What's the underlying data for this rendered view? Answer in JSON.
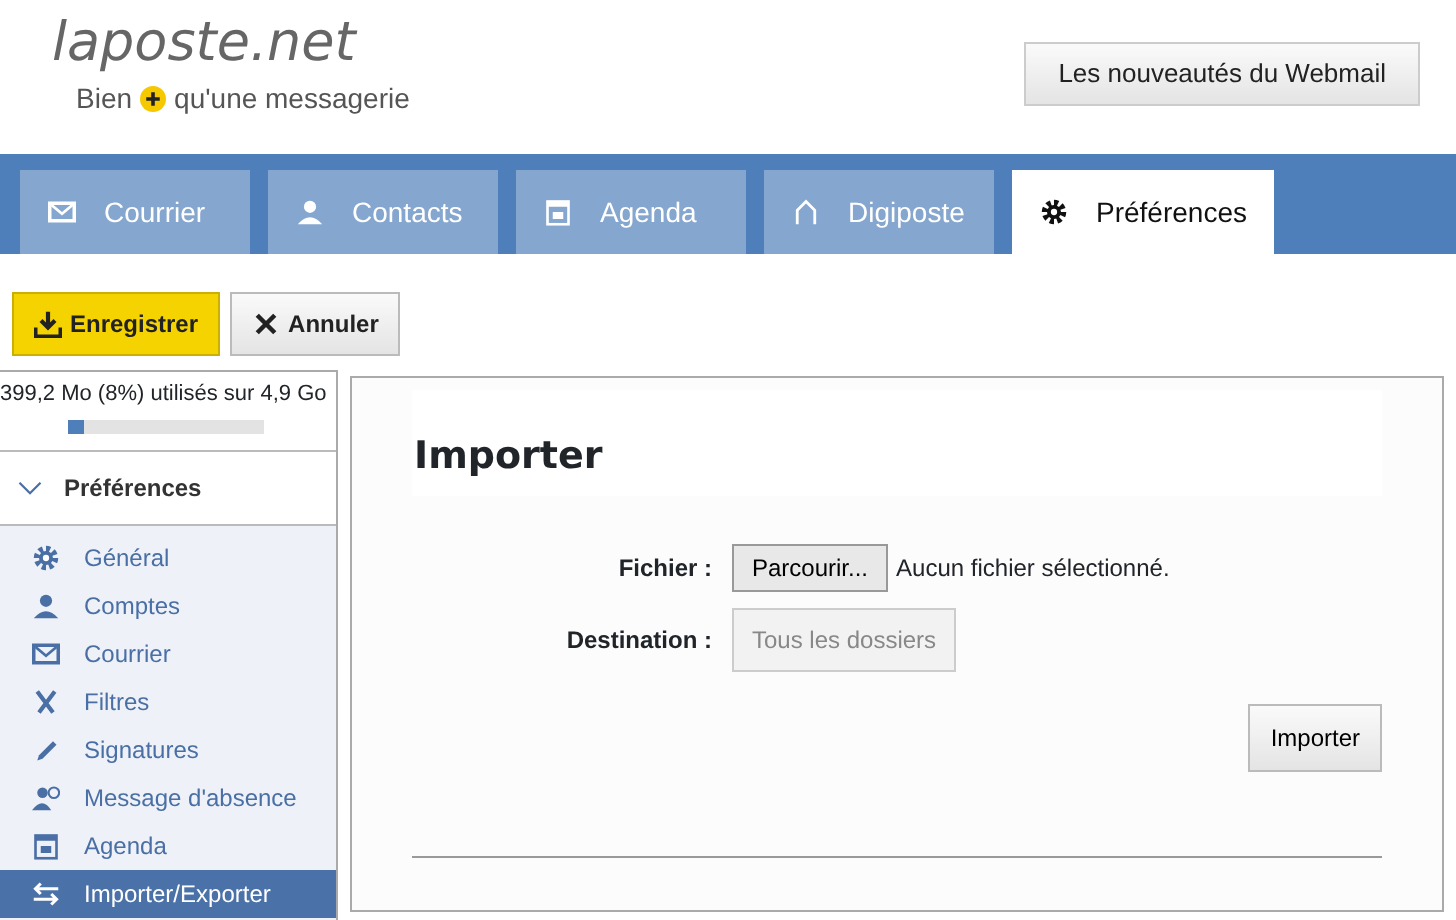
{
  "logo": {
    "brand": "laposte.net",
    "tagline_before": "Bien",
    "tagline_after": "qu'une messagerie"
  },
  "whats_new_button": "Les nouveautés du Webmail",
  "tabs": [
    {
      "label": "Courrier",
      "selected": false
    },
    {
      "label": "Contacts",
      "selected": false
    },
    {
      "label": "Agenda",
      "selected": false
    },
    {
      "label": "Digiposte",
      "selected": false
    },
    {
      "label": "Préférences",
      "selected": true
    }
  ],
  "toolbar": [
    {
      "label": "Enregistrer",
      "kind": "save"
    },
    {
      "label": "Annuler",
      "kind": "cancel"
    }
  ],
  "storage": {
    "text": "399,2 Mo (8%) utilisés sur 4,9 Go",
    "level": 0.08
  },
  "sidebar": {
    "title": "Préférences",
    "expanded": true,
    "items": [
      {
        "label": "Général",
        "selected": false
      },
      {
        "label": "Comptes",
        "selected": false
      },
      {
        "label": "Courrier",
        "selected": false
      },
      {
        "label": "Filtres",
        "selected": false
      },
      {
        "label": "Signatures",
        "selected": false
      },
      {
        "label": "Message d'absence",
        "selected": false
      },
      {
        "label": "Agenda",
        "selected": false
      },
      {
        "label": "Importer/Exporter",
        "selected": true
      }
    ]
  },
  "import": {
    "title": "Importer",
    "file_label": "Fichier :",
    "browse_button": "Parcourir...",
    "file_status": "Aucun fichier sélectionné.",
    "destination_label": "Destination :",
    "destination_value": "Tous les dossiers",
    "submit": "Importer"
  }
}
